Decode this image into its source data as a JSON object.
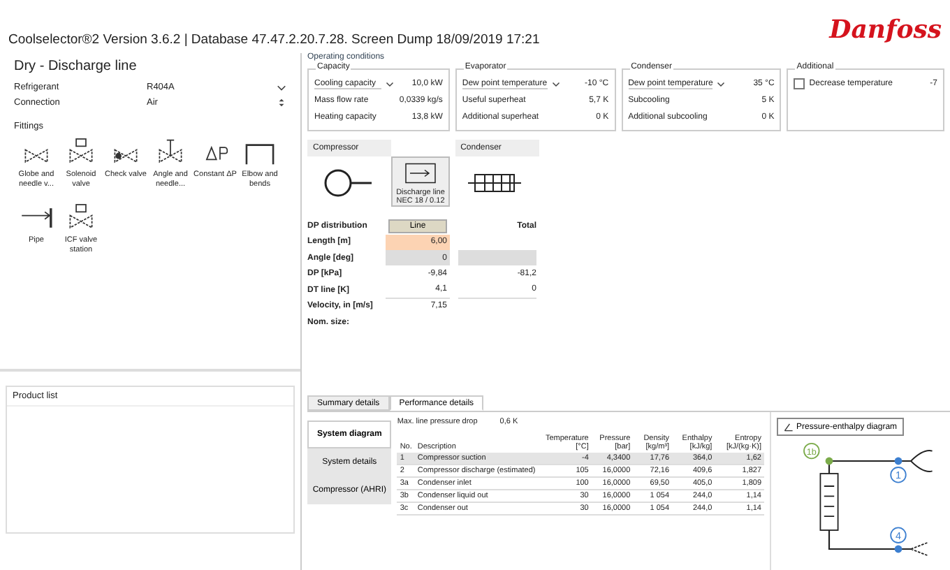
{
  "window": {
    "title": "Coolselector®2 Version 3.6.2 | Database 47.47.2.20.7.28. Screen Dump 18/09/2019 17:21",
    "logo": "Danfoss"
  },
  "line_panel": {
    "title": "Dry - Discharge line",
    "fields": [
      {
        "label": "Refrigerant",
        "value": "R404A",
        "kind": "dropdown"
      },
      {
        "label": "Connection",
        "value": "Air",
        "kind": "spinner"
      }
    ],
    "components_label": "Fittings",
    "components": [
      {
        "label": "Globe and needle v...",
        "kind": "globe"
      },
      {
        "label": "Solenoid valve",
        "kind": "solenoid"
      },
      {
        "label": "Check valve",
        "kind": "check"
      },
      {
        "label": "Angle and needle...",
        "kind": "angle"
      },
      {
        "label": "Constant ΔP",
        "kind": "dp"
      },
      {
        "label": "Elbow and bends",
        "kind": "bend"
      },
      {
        "label": "Pipe",
        "kind": "pipe"
      },
      {
        "label": "ICF valve station",
        "kind": "icf"
      }
    ],
    "notes_label": "Product list"
  },
  "conditions": {
    "title": "Operating conditions",
    "groups": [
      {
        "title": "Capacity",
        "rows": [
          {
            "label": "Cooling capacity",
            "value": "10,0 kW",
            "kind": "dropdown"
          },
          {
            "label": "Mass flow rate",
            "value": "0,0339 kg/s",
            "kind": "plain"
          },
          {
            "label": "Heating capacity",
            "value": "13,8 kW",
            "kind": "plain"
          }
        ]
      },
      {
        "title": "Evaporator",
        "rows": [
          {
            "label": "Dew point temperature",
            "value": "-10 °C",
            "kind": "dropdown"
          },
          {
            "label": "Useful superheat",
            "value": "5,7 K",
            "kind": "plain"
          },
          {
            "label": "Additional superheat",
            "value": "0 K",
            "kind": "plain"
          }
        ]
      },
      {
        "title": "Condenser",
        "rows": [
          {
            "label": "Dew point temperature",
            "value": "35 °C",
            "kind": "dropdown"
          },
          {
            "label": "Subcooling",
            "value": "5 K",
            "kind": "plain"
          },
          {
            "label": "Additional subcooling",
            "value": "0 K",
            "kind": "plain"
          }
        ]
      },
      {
        "title": "Additional",
        "rows": [
          {
            "label": "Decrease temperature",
            "value": "-7",
            "kind": "checkbox",
            "checked": false
          }
        ]
      }
    ]
  },
  "line": {
    "compressor": "Compressor",
    "condenser": "Condenser",
    "selected_label": "Discharge line",
    "selected_size": "NEC 18 / 0.12",
    "dp_label": "DP distribution",
    "dp_button": "Line",
    "total": "Total",
    "rows": [
      {
        "label": "Length [m]",
        "value": "6,00",
        "kind": "input"
      },
      {
        "label": "Angle [deg]",
        "value": "0",
        "kind": "grey"
      },
      {
        "label": "DP [kPa]",
        "value": "-9,84",
        "total": "-81,2",
        "kind": "plain"
      },
      {
        "label": "DT line [K]",
        "value": "4,1",
        "total": "0",
        "kind": "plain"
      },
      {
        "label": "Velocity, in [m/s]",
        "value": "7,15",
        "kind": "bare"
      },
      {
        "label": "Nom. size:",
        "kind": "bare"
      }
    ]
  },
  "tabs": [
    {
      "label": "Summary details",
      "selected": false
    },
    {
      "label": "Performance details",
      "selected": true
    }
  ],
  "side_tabs": [
    {
      "label": "System diagram",
      "selected": true
    },
    {
      "label": "System details",
      "selected": false
    },
    {
      "label": "Compressor (AHRI)",
      "selected": false
    }
  ],
  "drop_label": "Max. line pressure drop",
  "drop_value": "0,6 K",
  "table": {
    "columns": [
      "No.",
      "Description",
      "Temperature [°C]",
      "Pressure [bar]",
      "Density [kg/m³]",
      "Enthalpy [kJ/kg]",
      "Entropy [kJ/(kg·K)]"
    ],
    "rows": [
      {
        "cells": [
          "1",
          "Compressor suction",
          "-4",
          "4,3400",
          "17,76",
          "364,0",
          "1,62"
        ],
        "shaded": true
      },
      {
        "cells": [
          "2",
          "Compressor discharge (estimated)",
          "105",
          "16,0000",
          "72,16",
          "409,6",
          "1,827"
        ],
        "shaded": false
      },
      {
        "cells": [
          "3a",
          "Condenser inlet",
          "100",
          "16,0000",
          "69,50",
          "405,0",
          "1,809"
        ],
        "shaded": false
      },
      {
        "cells": [
          "3b",
          "Condenser liquid out",
          "30",
          "16,0000",
          "1 054",
          "244,0",
          "1,14"
        ],
        "shaded": false
      },
      {
        "cells": [
          "3c",
          "Condenser out",
          "30",
          "16,0000",
          "1 054",
          "244,0",
          "1,14"
        ],
        "shaded": false
      }
    ]
  },
  "diagram": {
    "button": "Pressure-enthalpy diagram",
    "points": [
      "1b",
      "1",
      "4"
    ]
  }
}
